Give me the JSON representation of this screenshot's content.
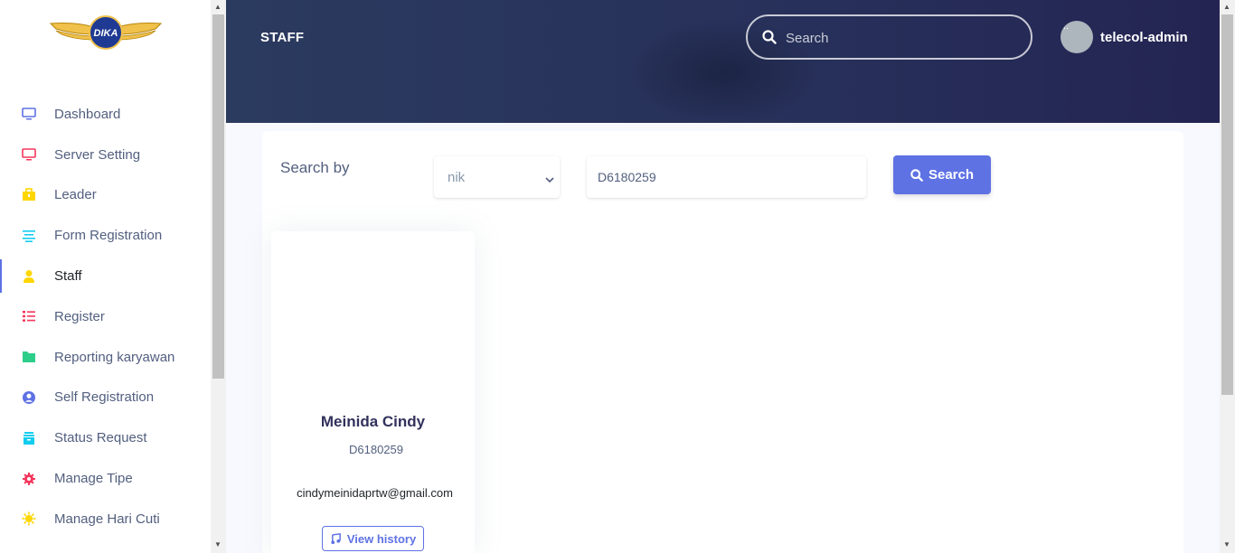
{
  "logo": {
    "text": "DIKA"
  },
  "sidebar": {
    "items": [
      {
        "label": "Dashboard",
        "icon": "monitor-icon",
        "color": "#5e72e4"
      },
      {
        "label": "Server Setting",
        "icon": "monitor-icon",
        "color": "#f5365c"
      },
      {
        "label": "Leader",
        "icon": "briefcase-icon",
        "color": "#ffd600"
      },
      {
        "label": "Form Registration",
        "icon": "align-center-icon",
        "color": "#11cdef"
      },
      {
        "label": "Staff",
        "icon": "user-icon",
        "color": "#ffd600"
      },
      {
        "label": "Register",
        "icon": "list-icon",
        "color": "#f5365c"
      },
      {
        "label": "Reporting karyawan",
        "icon": "folder-icon",
        "color": "#2dce89"
      },
      {
        "label": "Self Registration",
        "icon": "user-circle-icon",
        "color": "#5e72e4"
      },
      {
        "label": "Status Request",
        "icon": "archive-icon",
        "color": "#11cdef"
      },
      {
        "label": "Manage Tipe",
        "icon": "gear-icon",
        "color": "#f5365c"
      },
      {
        "label": "Manage Hari Cuti",
        "icon": "sun-icon",
        "color": "#ffd600"
      }
    ]
  },
  "header": {
    "title": "STAFF",
    "search_placeholder": "Search",
    "username": "telecol-admin",
    "avatar_alt": "..."
  },
  "filter": {
    "label": "Search by",
    "select_value": "nik",
    "input_value": "D6180259",
    "button_label": "Search"
  },
  "staff_card": {
    "name": "Meinida Cindy",
    "nik": "D6180259",
    "email": "cindymeinidaprtw@gmail.com",
    "history_button": "View history"
  },
  "colors": {
    "primary": "#5e72e4",
    "header_bg": "#27305a"
  }
}
